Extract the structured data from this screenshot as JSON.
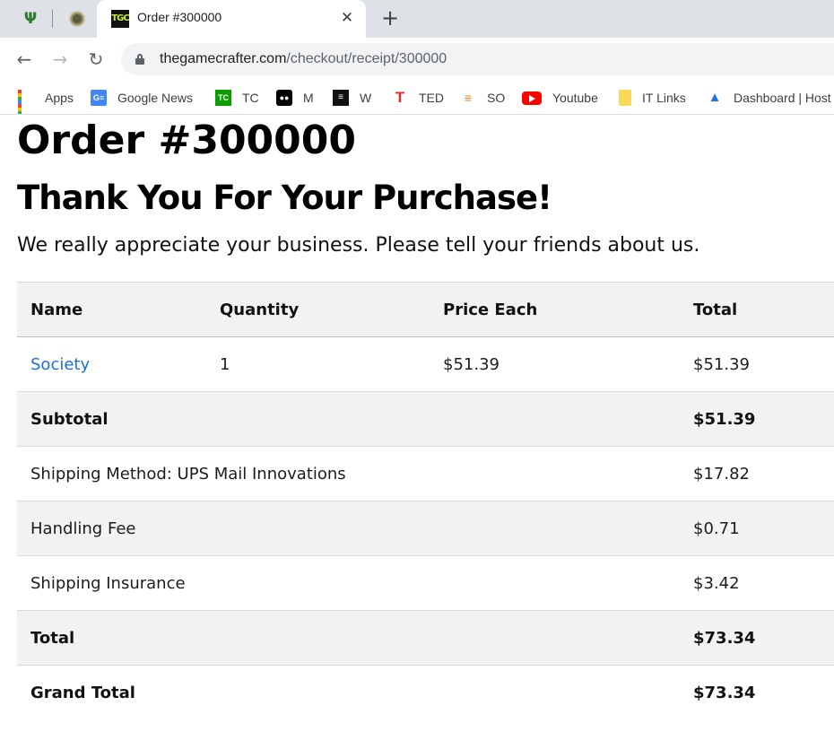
{
  "browser": {
    "tab": {
      "title": "Order #300000",
      "favicon_text": "TGC"
    },
    "pinned_tabs": [
      {
        "icon": "cactus-icon"
      },
      {
        "icon": "seal-icon"
      }
    ],
    "url": {
      "host": "thegamecrafter.com",
      "path": "/checkout/receipt/300000"
    },
    "bookmarks": [
      {
        "label": "Apps",
        "icon": "apps-grid-icon"
      },
      {
        "label": "Google News",
        "icon": "google-news-icon"
      },
      {
        "label": "TC",
        "icon": "techcrunch-icon"
      },
      {
        "label": "M",
        "icon": "medium-icon"
      },
      {
        "label": "W",
        "icon": "w-icon"
      },
      {
        "label": "TED",
        "icon": "ted-icon"
      },
      {
        "label": "SO",
        "icon": "stackoverflow-icon"
      },
      {
        "label": "Youtube",
        "icon": "youtube-icon"
      },
      {
        "label": "IT Links",
        "icon": "folder-icon"
      },
      {
        "label": "Dashboard | Host",
        "icon": "dashboard-icon"
      }
    ]
  },
  "page": {
    "order_title": "Order #300000",
    "thanks_title": "Thank You For Your Purchase!",
    "intro": "We really appreciate your business. Please tell your friends about us.",
    "table": {
      "headers": [
        "Name",
        "Quantity",
        "Price Each",
        "Total"
      ],
      "item": {
        "name": "Society",
        "quantity": "1",
        "price_each": "$51.39",
        "total": "$51.39"
      },
      "subtotal": {
        "label": "Subtotal",
        "value": "$51.39"
      },
      "shipping": {
        "label": "Shipping Method: UPS Mail Innovations",
        "value": "$17.82"
      },
      "handling": {
        "label": "Handling Fee",
        "value": "$0.71"
      },
      "insurance": {
        "label": "Shipping Insurance",
        "value": "$3.42"
      },
      "total": {
        "label": "Total",
        "value": "$73.34"
      },
      "grand_total": {
        "label": "Grand Total",
        "value": "$73.34"
      }
    }
  }
}
